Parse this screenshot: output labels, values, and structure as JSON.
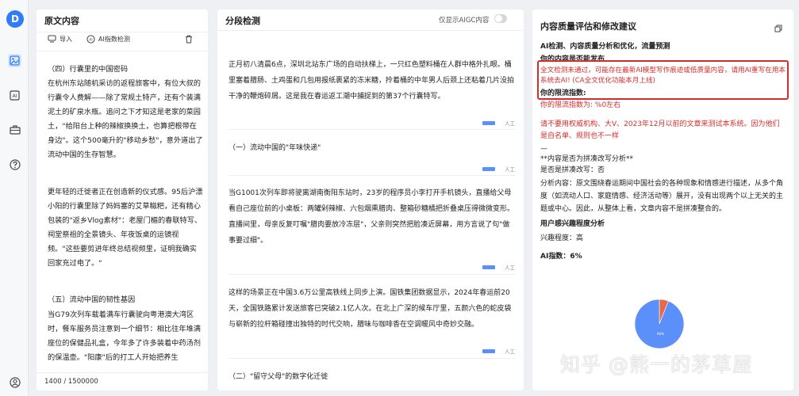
{
  "app": {
    "logo_letter": "D",
    "rail_icons": [
      "document-icon",
      "ai-icon",
      "briefcase-icon",
      "help-icon",
      "user-icon"
    ]
  },
  "left_panel": {
    "title": "原文内容",
    "import_label": "导入",
    "ai_detect_label": "AI指数检测",
    "paragraphs": [
      "（四）行囊里的中国密码",
      "在杭州东站随机采访的返程旅客中，有位大叔的行囊令人费解——除了常规土特产，还有个装满泥土的矿泉水瓶。追问之下才知这是老家的菜园土，\"给阳台上种的辣椒换换土，也算把根带在身边\"。这个500毫升的\"移动乡愁\"，意外道出了流动中国的生存智慧。",
      "更年轻的迁徙者正在创造新的仪式感。95后沪漂小阳的行囊里除了妈妈塞的艾草糍粑，还有精心包装的\"返乡Vlog素材\"：老屋门楣的春联特写、祠堂祭祖的全景镜头、年夜饭桌的运镜视频。\"这些要剪进年终总结视频里，证明我确实回家充过电了。\"",
      "（五）流动中国的韧性基因",
      "当G79次列车载着满车行囊驶向粤港澳大湾区时，餐车服务员注意到一个细节：相比往年堆满座位的保健品礼盒，今年多了许多装着中药汤剂的保温壶。\"阳康\"后的打工人开始把养生"
    ],
    "counter": "1400 / 1500000"
  },
  "middle_panel": {
    "title": "分段检测",
    "toggle_label": "仅显示AIGC内容",
    "segments": [
      {
        "text": "正月初八清晨6点，深圳北站东广场的自动扶梯上，一只红色塑料桶在人群中格外扎眼。桶里塞着腊肠、土鸡蛋和几包用报纸裹紧的冻米糖，拎着桶的中年男人后颈上还粘着几片没拍干净的鞭炮碎屑。这是我在春运返工潮中捕捉到的第37个行囊特写。",
        "tag": "人工"
      },
      {
        "text": "（一）流动中国的\"年味快递\"",
        "tag": "人工"
      },
      {
        "text": "当G1001次列车即将驶离湖南衡阳东站时，23岁的程序员小李打开手机镜头，直播给父母看自己座位前的小桌板：两罐剁辣椒、六包烟熏腊肉、整箱砂糖橘把折叠桌压得微微变形。直播间里，母亲反复叮嘱\"腊肉要放冷冻层\"，父亲则突然把脸凑近屏幕，用方言说了句\"做事要过细\"。",
        "tag": "人工"
      },
      {
        "text": "这样的场景正在中国3.6万公里高铁线上同步上演。国铁集团数据显示，2024年春运前20天，全国铁路累计发送旅客已突破2.1亿人次。在北上广深的候车厅里，五颜六色的蛇皮袋与崭新的拉杆箱碰撞出独特的时代交响，腊味与咖啡香在空调暖风中奇妙交融。",
        "tag": "人工"
      },
      {
        "text": "（二）\"留守父母\"的数字化迁徙",
        "tag": ""
      }
    ]
  },
  "right_panel": {
    "title": "内容质量评估和修改建议",
    "heading": "AI检测、内容质量分析和优化，流量预测",
    "pass_heading": "你的内容是否能发布",
    "pass_text": "全文检测未通过，可能存在最新AI模型写作痕迹或低质量内容，请用AI重写在用本系统去AI! (CA全文优化功能本月上线)",
    "limit_heading": "你的限流指数:",
    "limit_value": "你的限流指数为: %0左右",
    "warning": "请不要用权威机构、大V、2023年12月以前的文章来测试本系统。因为他们是自名单、规则也不一样",
    "dash": "—",
    "splice_heading": "**内容是否为拼凑改写分析**",
    "splice_is": "是否是拼凑改写：否",
    "splice_analysis": "分析内容：原文围绕春运期间中国社会的各种现象和情感进行描述，从多个角度（如流动人口、家庭情感、经济活动等）展开，没有出现两个以上无关的主题或中心。因此，从整体上看，文章内容不是拼凑整合的。",
    "interest_heading": "用户感兴趣程度分析",
    "interest_value": "兴趣程度：高",
    "ai_index_label": "AI指数：",
    "ai_index_value": "6%",
    "pie_label": "94%"
  },
  "chart_data": {
    "type": "pie",
    "title": "",
    "slices": [
      {
        "label": "人工",
        "value": 94,
        "color": "#5b8ff9"
      },
      {
        "label": "AI",
        "value": 6,
        "color": "#e8684a"
      }
    ],
    "slice_labels_printed": [
      "94%"
    ]
  },
  "watermark": "知乎 @熊一的茅草屋"
}
